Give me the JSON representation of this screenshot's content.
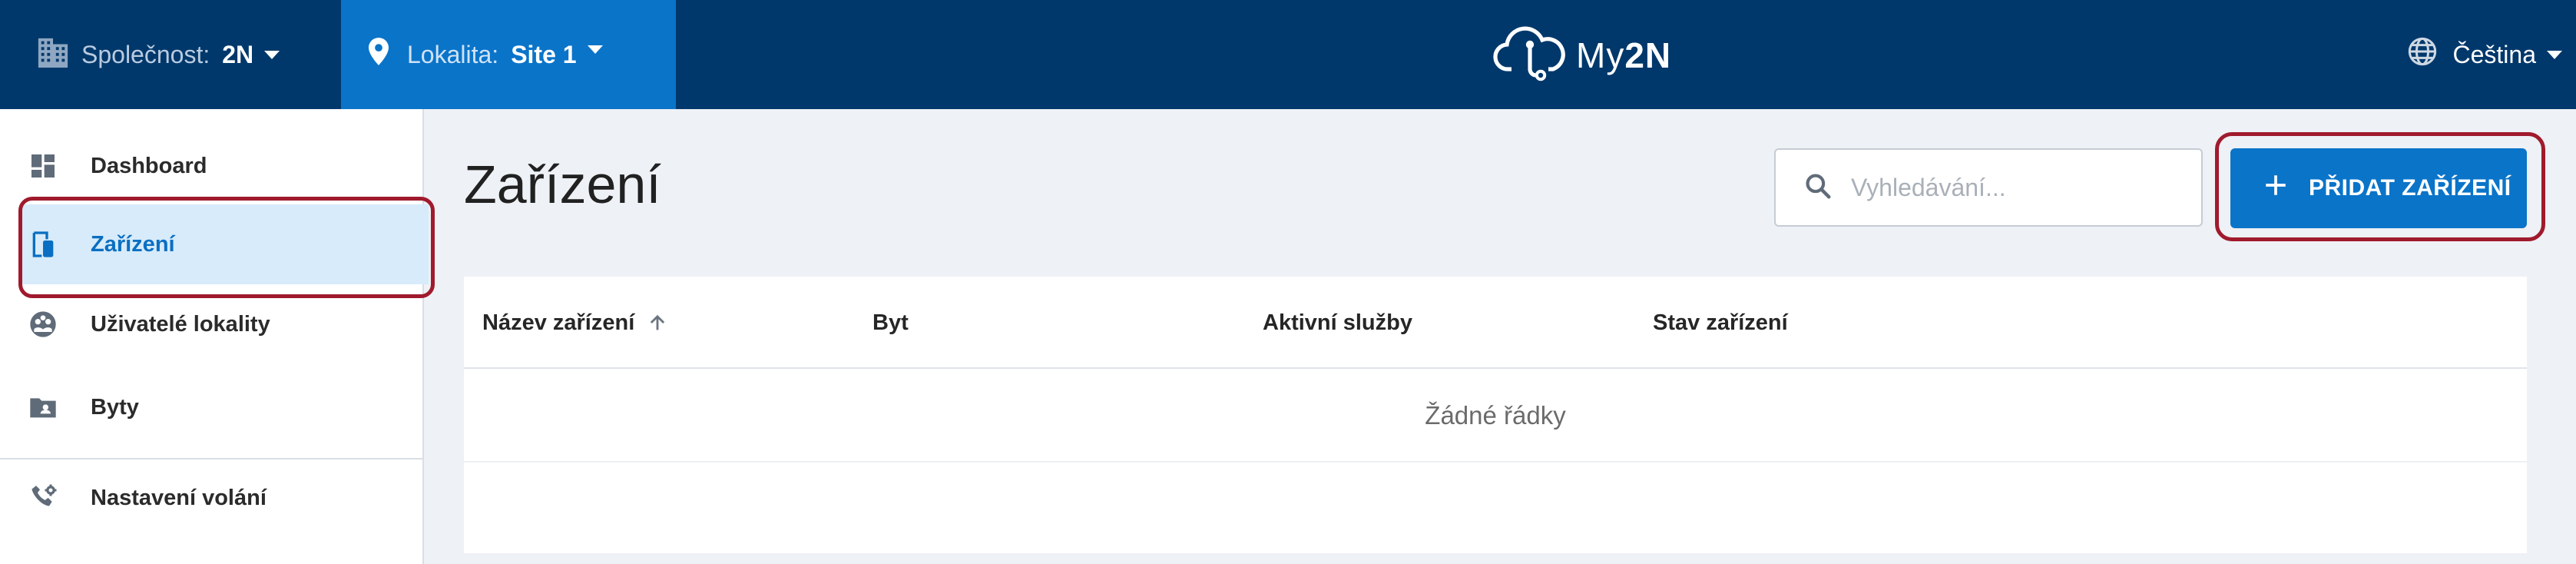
{
  "topbar": {
    "company_label": "Společnost:",
    "company_value": "2N",
    "site_label": "Lokalita:",
    "site_value": "Site 1",
    "logo_text_a": "My",
    "logo_text_b": "2N",
    "language": "Čeština"
  },
  "sidebar": {
    "items": [
      {
        "label": "Dashboard",
        "icon": "dashboard-icon"
      },
      {
        "label": "Zařízení",
        "icon": "devices-icon",
        "active": true
      },
      {
        "label": "Uživatelé lokality",
        "icon": "users-icon"
      },
      {
        "label": "Byty",
        "icon": "apartments-icon"
      },
      {
        "label": "Nastavení volání",
        "icon": "call-settings-icon"
      }
    ]
  },
  "main": {
    "title": "Zařízení",
    "search_placeholder": "Vyhledávání...",
    "add_button": "PŘIDAT ZAŘÍZENÍ",
    "table": {
      "columns": [
        "Název zařízení",
        "Byt",
        "Aktivní služby",
        "Stav zařízení"
      ],
      "empty_text": "Žádné řádky"
    }
  },
  "colors": {
    "topbar": "#00386b",
    "accent": "#0a74c9",
    "active_bg": "#d7ebfa",
    "highlight": "#a01a2d"
  }
}
